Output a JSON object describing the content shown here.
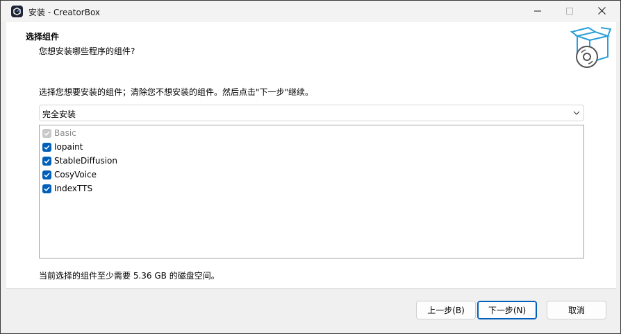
{
  "window": {
    "title": "安装 - CreatorBox",
    "app_icon": "creatorbox-logo-icon",
    "controls": [
      "minimize-icon",
      "maximize-icon",
      "close-icon"
    ]
  },
  "header": {
    "title": "选择组件",
    "subtitle": "您想安装哪些程序的组件?",
    "logo": "box-with-disc-icon"
  },
  "main": {
    "instruction": "选择您想要安装的组件；清除您不想安装的组件。然后点击\"下一步\"继续。",
    "install_type": {
      "selected": "完全安装"
    },
    "components": [
      {
        "label": "Basic",
        "checked": true,
        "disabled": true
      },
      {
        "label": "Iopaint",
        "checked": true,
        "disabled": false
      },
      {
        "label": "StableDiffusion",
        "checked": true,
        "disabled": false
      },
      {
        "label": "CosyVoice",
        "checked": true,
        "disabled": false
      },
      {
        "label": "IndexTTS",
        "checked": true,
        "disabled": false
      }
    ],
    "space_required": "当前选择的组件至少需要 5.36 GB 的磁盘空间。"
  },
  "footer": {
    "back_label": "上一步(B)",
    "next_label": "下一步(N)",
    "cancel_label": "取消"
  },
  "colors": {
    "accent": "#005fb8",
    "window_bg": "#f0f0f0",
    "panel_bg": "#ffffff"
  }
}
